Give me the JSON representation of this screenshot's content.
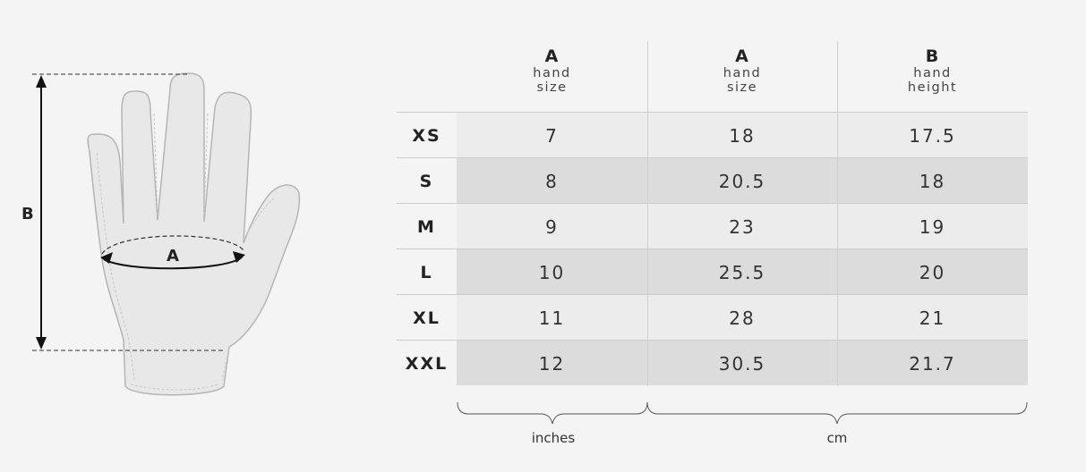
{
  "diagram": {
    "label_a": "A",
    "label_b": "B"
  },
  "table": {
    "headers": [
      {
        "letter": "A",
        "line1": "hand",
        "line2": "size"
      },
      {
        "letter": "A",
        "line1": "hand",
        "line2": "size"
      },
      {
        "letter": "B",
        "line1": "hand",
        "line2": "height"
      }
    ],
    "rows": [
      {
        "size": "XS",
        "values": [
          "7",
          "18",
          "17.5"
        ]
      },
      {
        "size": "S",
        "values": [
          "8",
          "20.5",
          "18"
        ]
      },
      {
        "size": "M",
        "values": [
          "9",
          "23",
          "19"
        ]
      },
      {
        "size": "L",
        "values": [
          "10",
          "25.5",
          "20"
        ]
      },
      {
        "size": "XL",
        "values": [
          "11",
          "28",
          "21"
        ]
      },
      {
        "size": "XXL",
        "values": [
          "12",
          "30.5",
          "21.7"
        ]
      }
    ],
    "units": {
      "inches": "inches",
      "cm": "cm"
    }
  },
  "colors": {
    "background": "#f4f4f4",
    "row_light": "#ececec",
    "row_dark": "#dcdcdc",
    "glove_fill": "#e8e8e8",
    "glove_outline": "#b5b5b5"
  }
}
